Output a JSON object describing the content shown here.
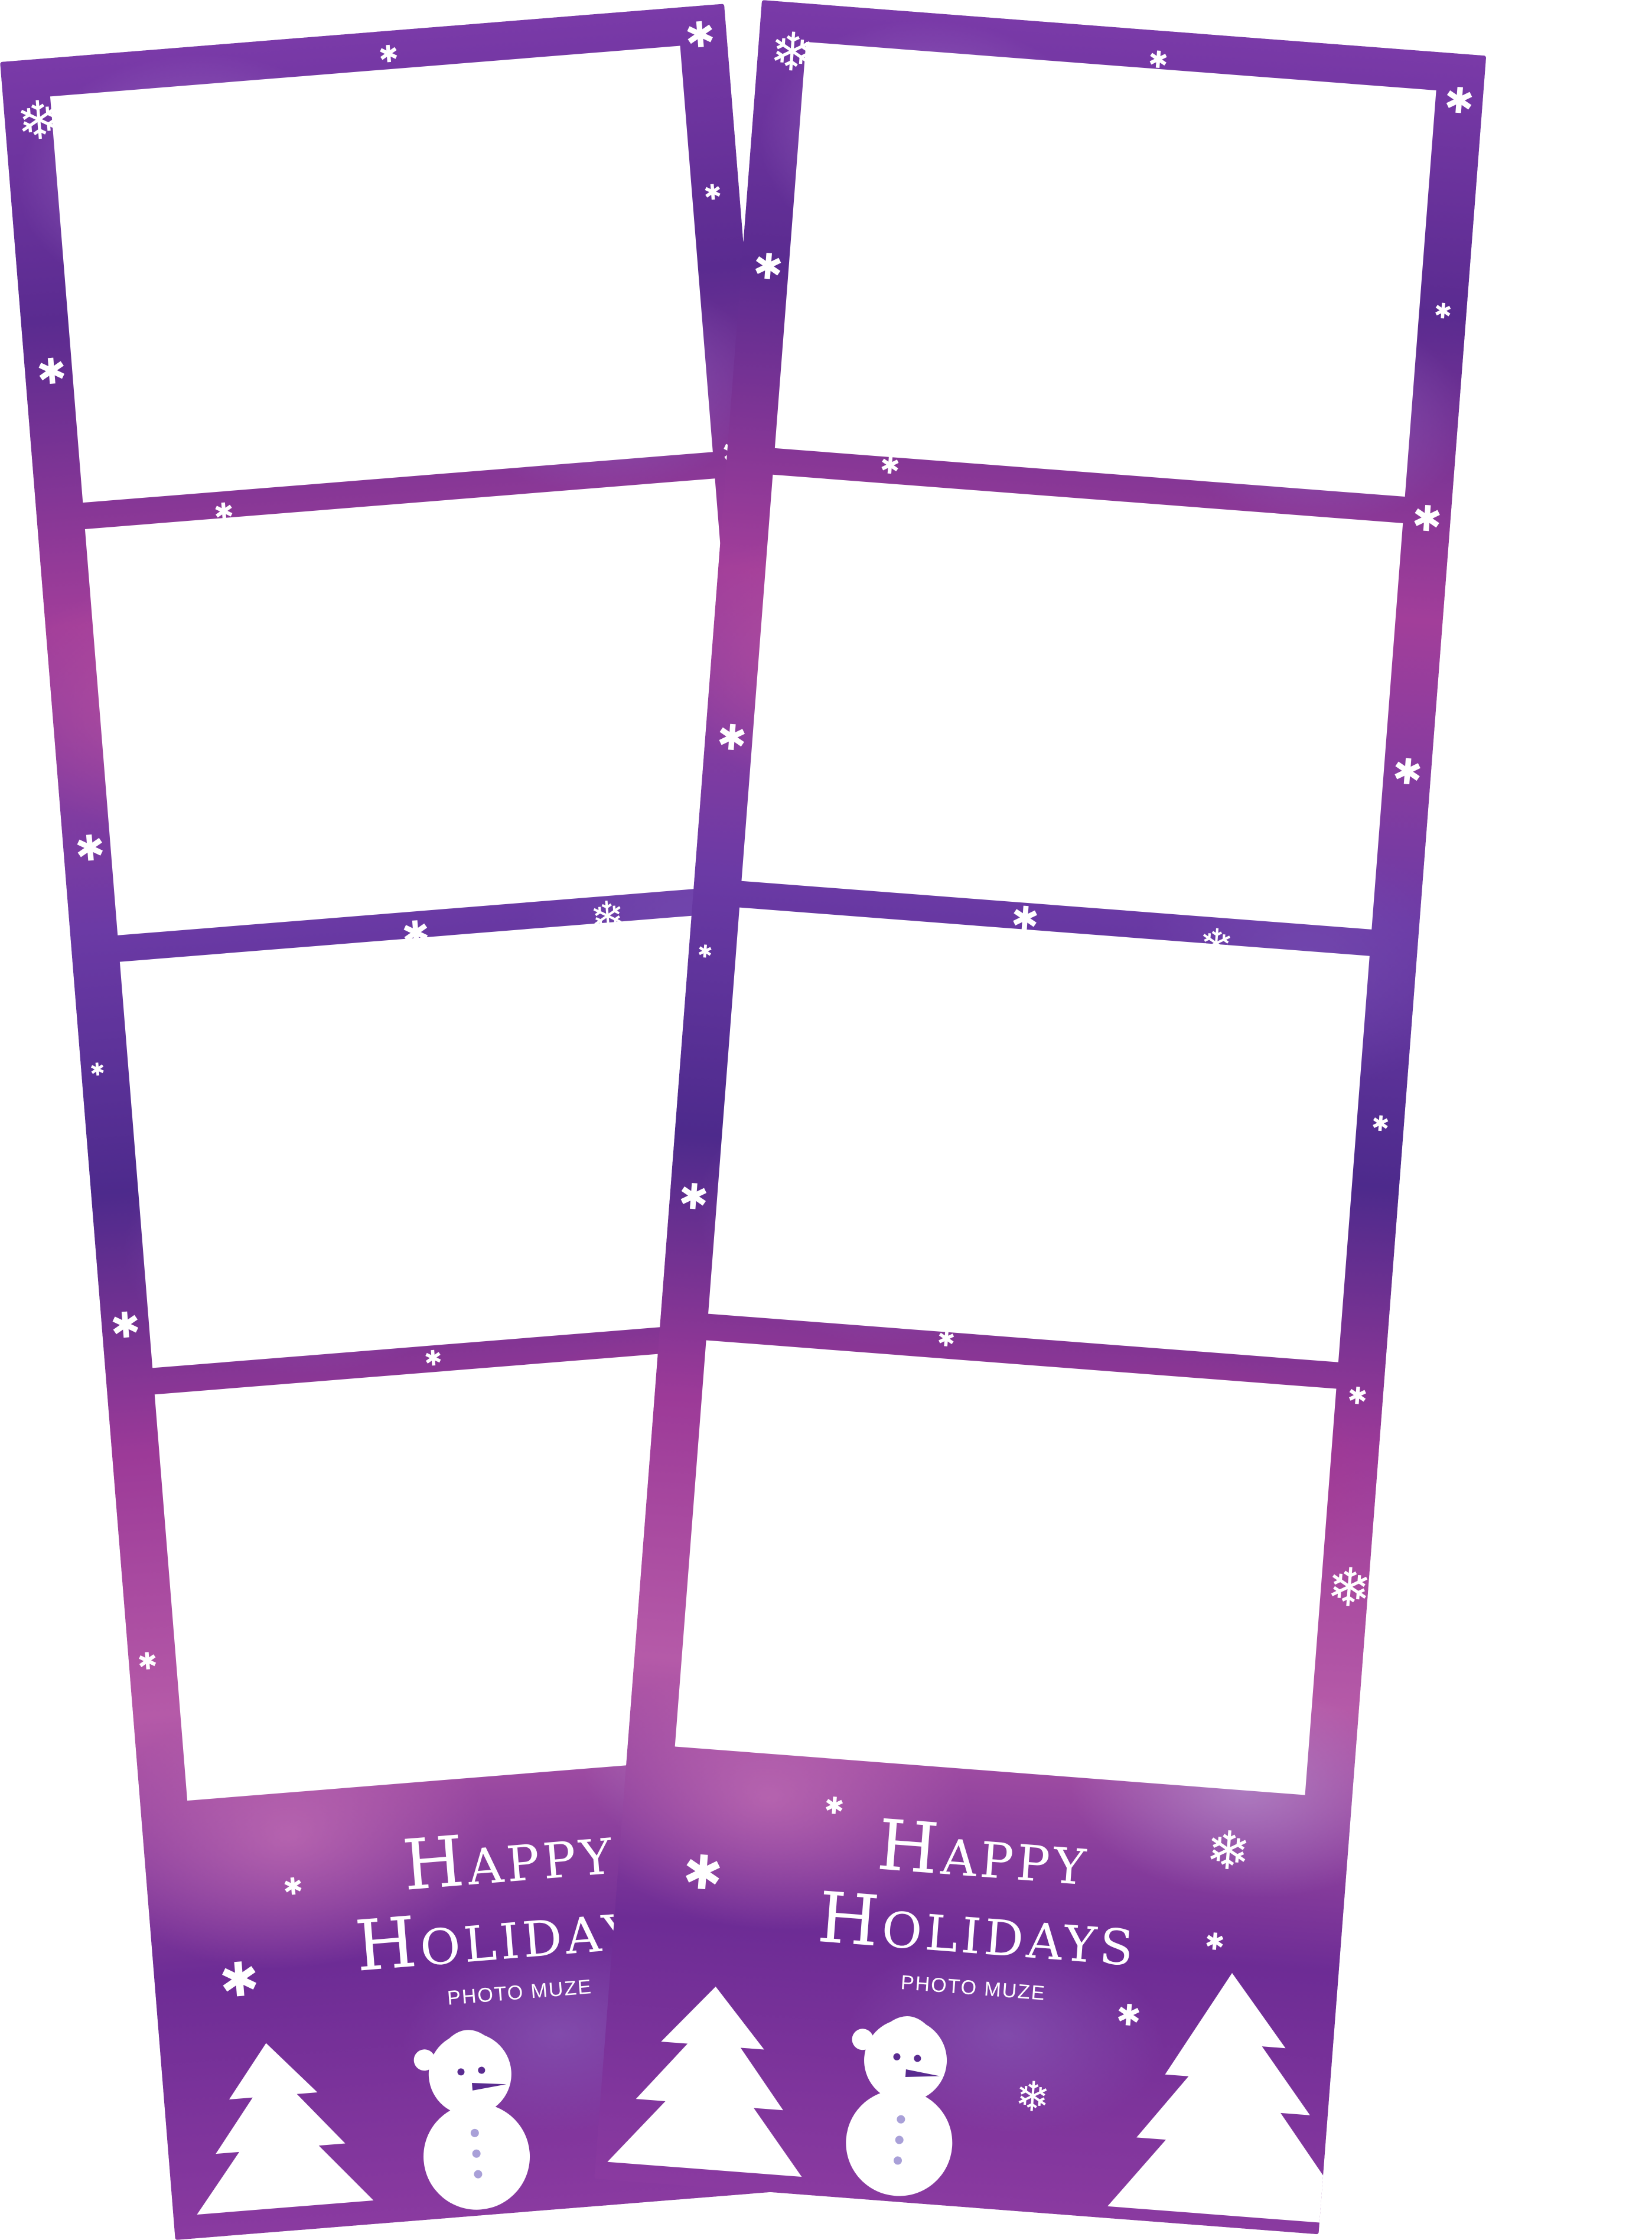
{
  "greeting": {
    "line1": "Happy",
    "line2": "Holidays"
  },
  "brand": "PHOTO MUZE",
  "colors": {
    "frame_dark": "#5a2b90",
    "frame_magenta": "#a23e9a",
    "frame_pink": "#c57ab5",
    "photo_slot": "#ffffff",
    "decor": "#ffffff"
  },
  "icons": [
    "snowflake-icon",
    "christmas-tree-icon",
    "snowman-icon"
  ],
  "strips": [
    {
      "photo_slots": 4
    },
    {
      "photo_slots": 4
    }
  ]
}
